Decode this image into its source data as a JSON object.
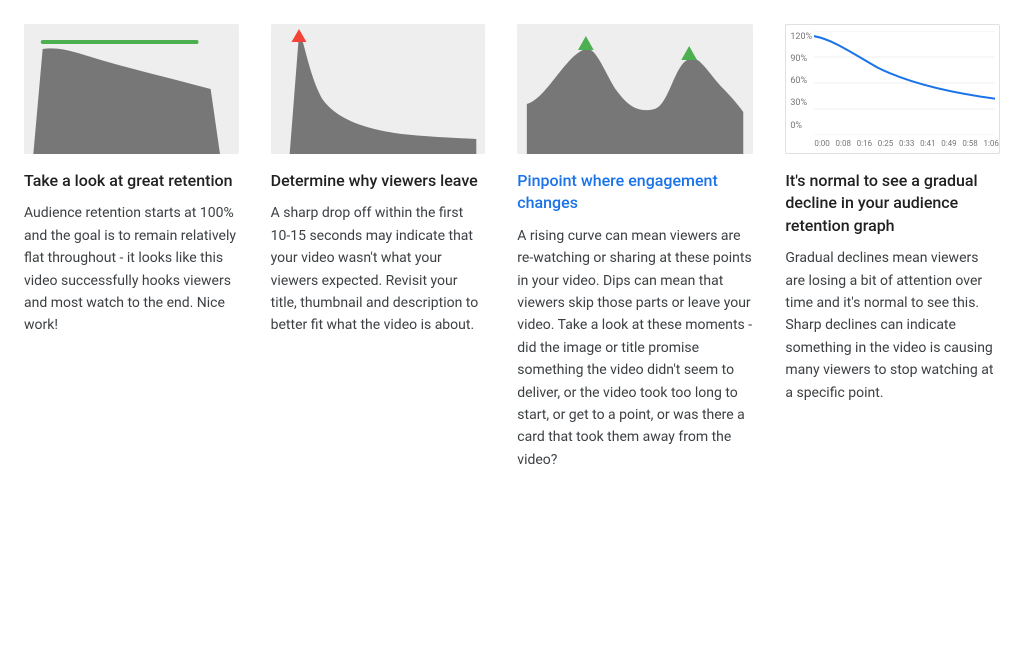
{
  "columns": [
    {
      "id": "great-retention",
      "title": "Take a look at great retention",
      "titleColor": "dark",
      "body": "Audience retention starts at 100% and the goal is to remain relatively flat throughout - it looks like this video successfully hooks viewers and most watch to the end. Nice work!",
      "chartType": "flat"
    },
    {
      "id": "viewers-leave",
      "title": "Determine why viewers leave",
      "titleColor": "dark",
      "body": "A sharp drop off within the first 10-15 seconds may indicate that your video wasn't what your viewers expected. Revisit your title, thumbnail and description to better fit what the video is about.",
      "chartType": "sharp-drop"
    },
    {
      "id": "engagement-changes",
      "title": "Pinpoint where engagement changes",
      "titleColor": "blue",
      "body": "A rising curve can mean viewers are re-watching or sharing at these points in your video. Dips can mean that viewers skip those parts or leave your video. Take a look at these moments - did the image or title promise something the video didn't seem to deliver, or the video took too long to start, or get to a point, or was there a card that took them away from the video?",
      "chartType": "peaks"
    },
    {
      "id": "gradual-decline",
      "title": "It's normal to see a gradual decline in your audience retention graph",
      "titleColor": "dark",
      "body": "Gradual declines mean viewers are losing a bit of attention over time and it's normal to see this. Sharp declines can indicate something in the video is causing many viewers to stop watching at a specific point.",
      "chartType": "gradual",
      "yLabels": [
        "120%",
        "90%",
        "60%",
        "30%",
        "0%"
      ],
      "xLabels": [
        "0:00",
        "0:08",
        "0:16",
        "0:25",
        "0:33",
        "0:41",
        "0:49",
        "0:58",
        "1:06"
      ]
    }
  ]
}
